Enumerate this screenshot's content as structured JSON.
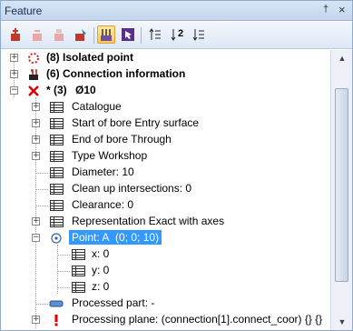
{
  "window": {
    "title": "Feature",
    "pin_glyph": "†",
    "close_glyph": "×"
  },
  "toolbar": {
    "buttons": [
      {
        "icon": "add-feature-icon",
        "enabled": true
      },
      {
        "icon": "remove-feature-icon",
        "enabled": false
      },
      {
        "icon": "copy-feature-icon",
        "enabled": false
      },
      {
        "icon": "edit-feature-icon",
        "enabled": true
      },
      {
        "icon": "feature-tree-icon",
        "active": true
      },
      {
        "icon": "select-arrow-icon",
        "enabled": true
      },
      {
        "icon": "sort-asc-icon",
        "enabled": true
      },
      {
        "icon": "sort-desc-icon",
        "enabled": true
      },
      {
        "icon": "sort-list-icon",
        "enabled": true
      }
    ],
    "sort_desc_number": "2"
  },
  "tree": {
    "isolated": "(8) Isolated point",
    "connection": "(6) Connection information",
    "bore_prefix": "* (3)",
    "bore_name": "Ø10",
    "catalogue": "Catalogue",
    "start": "Start of bore Entry surface",
    "end": "End of bore Through",
    "type": "Type Workshop",
    "diameter": "Diameter: 10",
    "cleanup": "Clean up intersections: 0",
    "clearance": "Clearance: 0",
    "representation": "Representation Exact with axes",
    "point_label": "Point: A",
    "point_value": "(0; 0; 10)",
    "x": "x: 0",
    "y": "y: 0",
    "z": "z: 0",
    "processed_part": "Processed part: -",
    "processing_plane": "Processing plane: (connection[1].connect_coor) {} {}"
  },
  "scrollbar": {
    "up": "▲",
    "down": "▼"
  },
  "colors": {
    "selection": "#3399ff",
    "title_bg": "#c3d6ee",
    "error_red": "#e00000"
  }
}
